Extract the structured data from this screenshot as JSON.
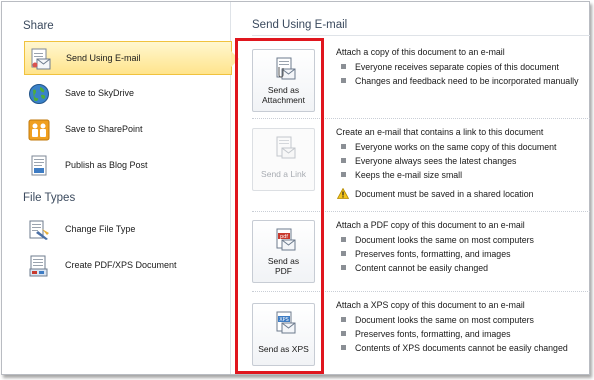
{
  "left": {
    "share_heading": "Share",
    "share_items": [
      {
        "label": "Send Using E-mail",
        "icon": "email-icon",
        "selected": true
      },
      {
        "label": "Save to SkyDrive",
        "icon": "globe-icon",
        "selected": false
      },
      {
        "label": "Save to SharePoint",
        "icon": "sharepoint-icon",
        "selected": false
      },
      {
        "label": "Publish as Blog Post",
        "icon": "blog-icon",
        "selected": false
      }
    ],
    "file_types_heading": "File Types",
    "file_type_items": [
      {
        "label": "Change File Type",
        "icon": "change-file-type-icon"
      },
      {
        "label": "Create PDF/XPS Document",
        "icon": "pdf-xps-icon"
      }
    ]
  },
  "right": {
    "title": "Send Using E-mail",
    "options": [
      {
        "button_label": "Send as Attachment",
        "icon": "attachment-icon",
        "enabled": true,
        "heading": "Attach a copy of this document to an e-mail",
        "bullets": [
          "Everyone receives separate copies of this document",
          "Changes and feedback need to be incorporated manually"
        ]
      },
      {
        "button_label": "Send a Link",
        "icon": "link-icon",
        "enabled": false,
        "heading": "Create an e-mail that contains a link to this document",
        "bullets": [
          "Everyone works on the same copy of this document",
          "Everyone always sees the latest changes",
          "Keeps the e-mail size small"
        ],
        "warning": "Document must be saved in a shared location"
      },
      {
        "button_label": "Send as PDF",
        "icon": "pdf-icon",
        "enabled": true,
        "heading": "Attach a PDF copy of this document to an e-mail",
        "bullets": [
          "Document looks the same on most computers",
          "Preserves fonts, formatting, and images",
          "Content cannot be easily changed"
        ]
      },
      {
        "button_label": "Send as XPS",
        "icon": "xps-icon",
        "enabled": true,
        "heading": "Attach a XPS copy of this document to an e-mail",
        "bullets": [
          "Document looks the same on most computers",
          "Preserves fonts, formatting, and images",
          "Contents of XPS documents cannot be easily changed"
        ]
      }
    ]
  },
  "colors": {
    "highlight_box": "#e0161e",
    "selected_item": "#ffe48c",
    "heading_text": "#3b4a5e"
  }
}
